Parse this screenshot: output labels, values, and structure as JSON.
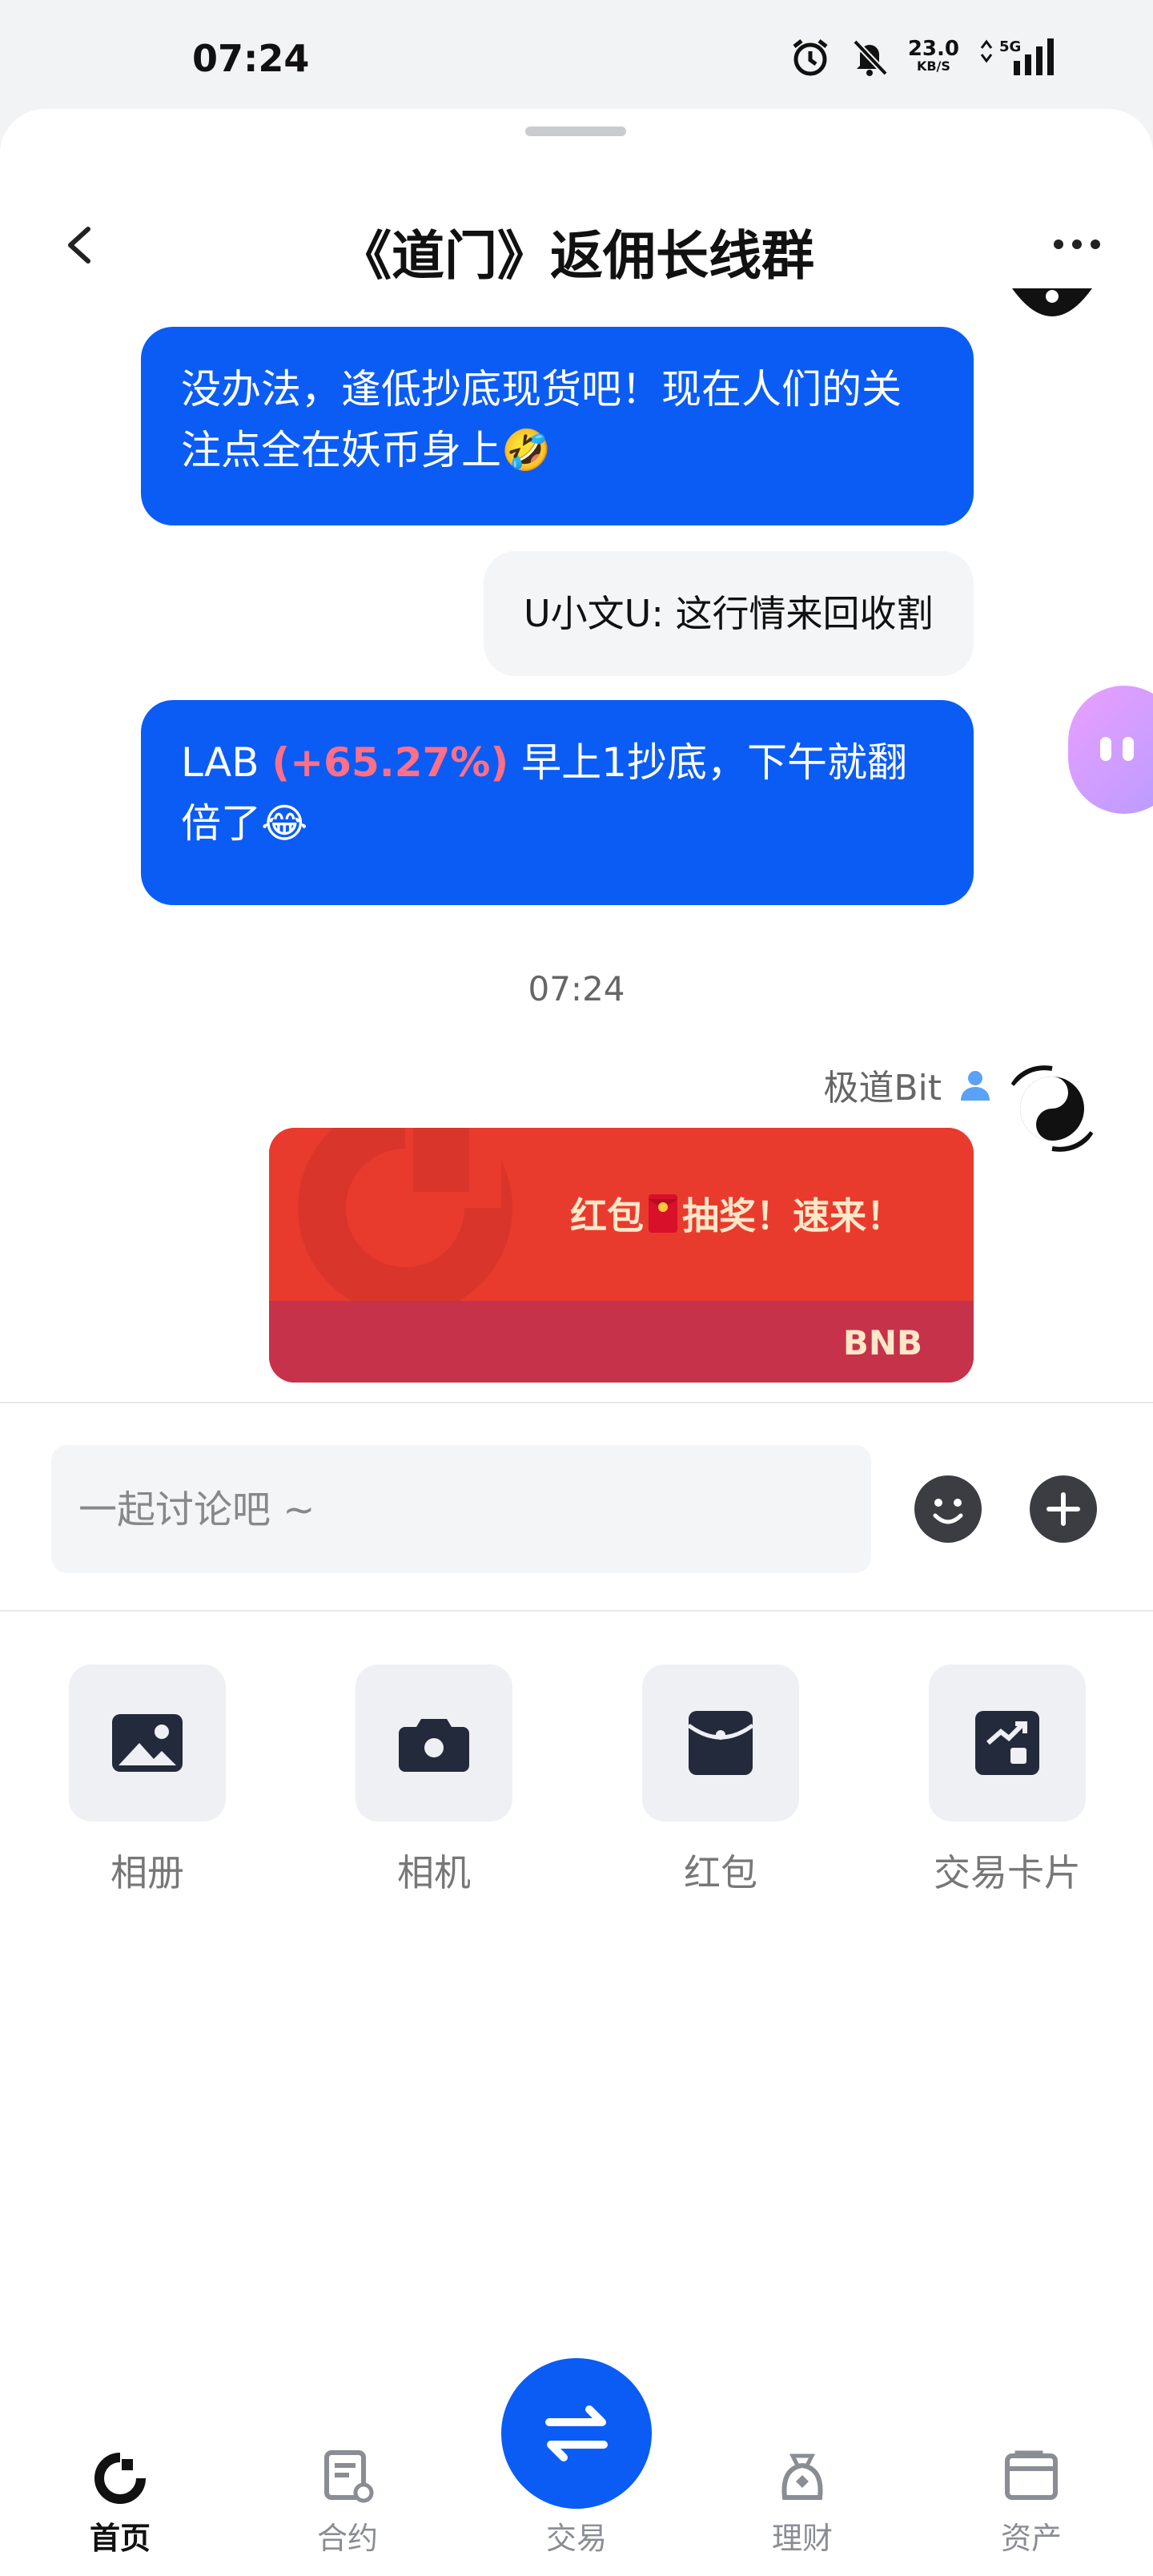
{
  "status_bar": {
    "time": "07:24",
    "speed_value": "23.0",
    "speed_unit": "KB/S",
    "network": "5G"
  },
  "header": {
    "title": "《道门》返佣长线群"
  },
  "messages": [
    {
      "type": "text",
      "text": "没办法，逢低抄底现货吧！现在人们的关注点全在妖币身上🤣"
    },
    {
      "type": "text_grey",
      "text": "U小文U: 这行情来回收割"
    },
    {
      "type": "text_rich",
      "prefix": "LAB ",
      "highlight": "(+65.27%)",
      "suffix": " 早上1抄底，下午就翻倍了😂"
    }
  ],
  "timestamp": "07:24",
  "sender": {
    "name": "极道Bit"
  },
  "red_packet": {
    "text_before": "红包",
    "text_after": "抽奖！速来！",
    "coin": "BNB"
  },
  "composer": {
    "placeholder": "一起讨论吧 ~"
  },
  "tools": [
    {
      "label": "相册",
      "icon": "image-icon"
    },
    {
      "label": "相机",
      "icon": "camera-icon"
    },
    {
      "label": "红包",
      "icon": "red-packet-icon"
    },
    {
      "label": "交易卡片",
      "icon": "trade-card-icon"
    }
  ],
  "tabbar": {
    "home": "首页",
    "contract": "合约",
    "trade": "交易",
    "finance": "理财",
    "assets": "资产"
  },
  "colors": {
    "primary": "#0a5cf5",
    "positive": "#ff6f88",
    "red_packet": "#e83b2e"
  }
}
